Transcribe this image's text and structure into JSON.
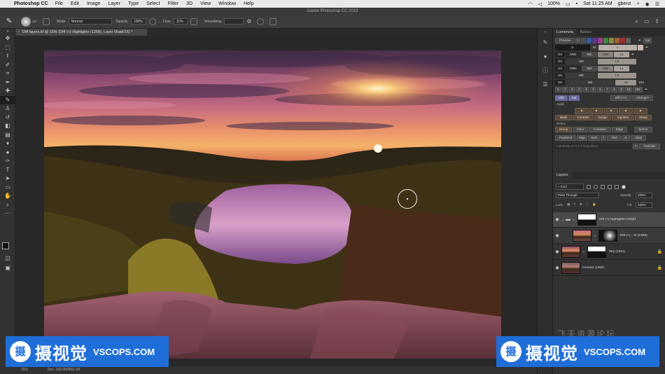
{
  "menubar": {
    "app_name": "Photoshop CC",
    "items": [
      "File",
      "Edit",
      "Image",
      "Layer",
      "Type",
      "Select",
      "Filter",
      "3D",
      "View",
      "Window",
      "Help"
    ],
    "battery": "100%",
    "clock": "Sat 11:25 AM",
    "user": "gbenz"
  },
  "window_title": "Adobe Photoshop CC 2019",
  "options": {
    "brush_size": "250",
    "mode_label": "Mode:",
    "mode_value": "Normal",
    "opacity_label": "Opacity:",
    "opacity_value": "100%",
    "flow_label": "Flow:",
    "flow_value": "11%",
    "smoothing_label": "Smoothing:"
  },
  "document": {
    "tab_title": "Diff layers.tif @ 16% (Diff (+) Highlights (1258), Layer Mask/16) *",
    "zoom": "16%",
    "doc_size": "Doc: 260.0M/806.1M"
  },
  "luminosity_panel": {
    "tabs": [
      "Lumenzia",
      "Basics"
    ],
    "preview_label": "Preview",
    "sat_label": "Sat",
    "zone_rows": [
      [
        "D",
        "M",
        "L"
      ],
      [
        "D2",
        "DM1",
        "M2",
        "LM1",
        "L2"
      ],
      [
        "D3",
        "M3",
        "L3"
      ],
      [
        "D4",
        "DM2",
        "M4",
        "LM2",
        "L4"
      ],
      [
        "D5",
        "M5",
        "L5"
      ],
      [
        "D6",
        "M6",
        "L6"
      ]
    ],
    "zone_numbers": [
      "0",
      "1",
      "2",
      "3",
      "4",
      "5",
      "6",
      "7",
      "8",
      "9",
      "10"
    ],
    "zone_end": "255",
    "side_value": "164",
    "vibe_buttons": [
      "Vibr",
      "Sat",
      "Diff (+/-)",
      "<Range>"
    ],
    "apply_label": "Apply",
    "apply_buttons": [
      "Mask",
      "Contrast",
      "Dodge",
      "Vignette",
      "Sharp"
    ],
    "refine_label": "Refine",
    "refine_buttons": [
      "Group",
      "Color",
      "Combine",
      "Edge",
      "Before"
    ],
    "bottom_buttons": [
      "PreBlend",
      "Map",
      "Split",
      "f",
      "√Sel",
      "√L",
      "√dust"
    ],
    "footer": "Lumenzia v7.0.0 ©Greg Benz",
    "tutorials": "Tutorials"
  },
  "layers_panel": {
    "tab": "Layers",
    "filter_kind": "Kind",
    "blend_mode": "Pass Through",
    "opacity_label": "Opacity:",
    "opacity_value": "100%",
    "lock_label": "Lock:",
    "fill_label": "Fill:",
    "fill_value": "100%",
    "layers": [
      {
        "name": "Diff (+) Highlights (1258)",
        "selected": true
      },
      {
        "name": "Diff (+) ...ts (1258)",
        "selected": false
      },
      {
        "name": "Sky (1251)",
        "selected": false
      },
      {
        "name": "Ground (1262)",
        "selected": false
      }
    ]
  },
  "watermarks": {
    "cn_text": "摄视觉",
    "en_text": "VSCOPS.COM",
    "logo_char": "摄",
    "faint_text": "飞天资源论坛"
  },
  "colors": {
    "accent": "#1f6ed8",
    "panel_bg": "#323232",
    "canvas_bg": "#282828"
  }
}
